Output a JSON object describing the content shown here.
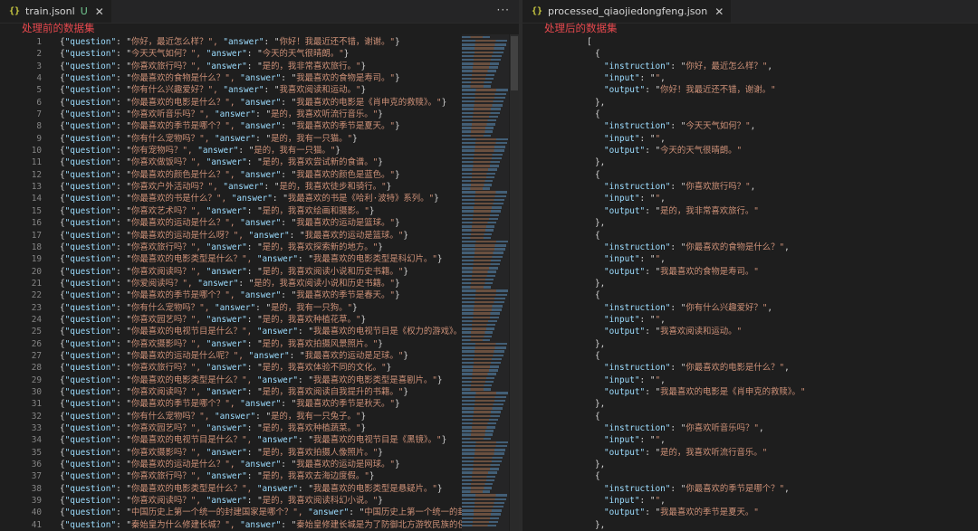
{
  "left": {
    "tab": {
      "icon": "json-braces-icon",
      "name": "train.jsonl",
      "status": "U"
    },
    "annotation": "处理前的数据集",
    "lines": [
      {
        "n": "1",
        "q": "你好，最近怎么样？",
        "a": "你好！我最近还不错，谢谢。"
      },
      {
        "n": "2",
        "q": "今天天气如何？",
        "a": "今天的天气很晴朗。"
      },
      {
        "n": "3",
        "q": "你喜欢旅行吗？",
        "a": "是的，我非常喜欢旅行。"
      },
      {
        "n": "4",
        "q": "你最喜欢的食物是什么？",
        "a": "我最喜欢的食物是寿司。"
      },
      {
        "n": "5",
        "q": "你有什么兴趣爱好？",
        "a": "我喜欢阅读和运动。"
      },
      {
        "n": "6",
        "q": "你最喜欢的电影是什么？",
        "a": "我最喜欢的电影是《肖申克的救赎》。"
      },
      {
        "n": "7",
        "q": "你喜欢听音乐吗？",
        "a": "是的，我喜欢听流行音乐。"
      },
      {
        "n": "8",
        "q": "你最喜欢的季节是哪个？",
        "a": "我最喜欢的季节是夏天。"
      },
      {
        "n": "9",
        "q": "你有什么宠物吗？",
        "a": "是的，我有一只猫。"
      },
      {
        "n": "10",
        "q": "你有宠物吗？",
        "a": "是的，我有一只猫。"
      },
      {
        "n": "11",
        "q": "你喜欢做饭吗？",
        "a": "是的，我喜欢尝试新的食谱。"
      },
      {
        "n": "12",
        "q": "你最喜欢的颜色是什么？",
        "a": "我最喜欢的颜色是蓝色。"
      },
      {
        "n": "13",
        "q": "你喜欢户外活动吗？",
        "a": "是的，我喜欢徒步和骑行。"
      },
      {
        "n": "14",
        "q": "你最喜欢的书是什么？",
        "a": "我最喜欢的书是《哈利·波特》系列。"
      },
      {
        "n": "15",
        "q": "你喜欢艺术吗？",
        "a": "是的，我喜欢绘画和摄影。"
      },
      {
        "n": "16",
        "q": "你最喜欢的运动是什么？",
        "a": "我最喜欢的运动是篮球。"
      },
      {
        "n": "17",
        "q": "你最喜欢的运动是什么呀？",
        "a": "我最喜欢的运动是篮球。"
      },
      {
        "n": "18",
        "q": "你喜欢旅行吗？",
        "a": "是的，我喜欢探索新的地方。"
      },
      {
        "n": "19",
        "q": "你最喜欢的电影类型是什么？",
        "a": "我最喜欢的电影类型是科幻片。"
      },
      {
        "n": "20",
        "q": "你喜欢阅读吗？",
        "a": "是的，我喜欢阅读小说和历史书籍。"
      },
      {
        "n": "21",
        "q": "你爱阅读吗？",
        "a": "是的，我喜欢阅读小说和历史书籍。"
      },
      {
        "n": "22",
        "q": "你最喜欢的季节是哪个？",
        "a": "我最喜欢的季节是春天。"
      },
      {
        "n": "23",
        "q": "你有什么宠物吗？",
        "a": "是的，我有一只狗。"
      },
      {
        "n": "24",
        "q": "你喜欢园艺吗？",
        "a": "是的，我喜欢种植花草。"
      },
      {
        "n": "25",
        "q": "你最喜欢的电视节目是什么？",
        "a": "我最喜欢的电视节目是《权力的游戏》。"
      },
      {
        "n": "26",
        "q": "你喜欢摄影吗？",
        "a": "是的，我喜欢拍摄风景照片。"
      },
      {
        "n": "27",
        "q": "你最喜欢的运动是什么呢？",
        "a": "我最喜欢的运动是足球。"
      },
      {
        "n": "28",
        "q": "你喜欢旅行吗？",
        "a": "是的，我喜欢体验不同的文化。"
      },
      {
        "n": "29",
        "q": "你最喜欢的电影类型是什么？",
        "a": "我最喜欢的电影类型是喜剧片。"
      },
      {
        "n": "30",
        "q": "你喜欢阅读吗？",
        "a": "是的，我喜欢阅读自我提升的书籍。"
      },
      {
        "n": "31",
        "q": "你最喜欢的季节是哪个？",
        "a": "我最喜欢的季节是秋天。"
      },
      {
        "n": "32",
        "q": "你有什么宠物吗？",
        "a": "是的，我有一只兔子。"
      },
      {
        "n": "33",
        "q": "你喜欢园艺吗？",
        "a": "是的，我喜欢种植蔬菜。"
      },
      {
        "n": "34",
        "q": "你最喜欢的电视节目是什么？",
        "a": "我最喜欢的电视节目是《黑镜》。"
      },
      {
        "n": "35",
        "q": "你喜欢摄影吗？",
        "a": "是的，我喜欢拍摄人像照片。"
      },
      {
        "n": "36",
        "q": "你最喜欢的运动是什么？",
        "a": "我最喜欢的运动是网球。"
      },
      {
        "n": "37",
        "q": "你喜欢旅行吗？",
        "a": "是的，我喜欢去海边度假。"
      },
      {
        "n": "38",
        "q": "你最喜欢的电影类型是什么？",
        "a": "我最喜欢的电影类型是悬疑片。"
      },
      {
        "n": "39",
        "q": "你喜欢阅读吗？",
        "a": "是的，我喜欢阅读科幻小说。"
      },
      {
        "n": "40",
        "q": "中国历史上第一个统一的封建国家是哪个？",
        "a": "中国历史上第一个统一的封建国"
      },
      {
        "n": "41",
        "q": "秦始皇为什么修建长城？",
        "a": "秦始皇修建长城是为了防御北方游牧民族的侵扰。"
      }
    ]
  },
  "right": {
    "tab": {
      "icon": "json-braces-icon",
      "name": "processed_qiaojiedongfeng.json"
    },
    "annotation": "处理后的数据集",
    "lines": [
      {
        "n": "1",
        "kind": "open_bracket",
        "text": "["
      },
      {
        "n": "2",
        "kind": "open",
        "text": "{"
      },
      {
        "n": "3",
        "kind": "kv",
        "k": "instruction",
        "v": "你好，最近怎么样？"
      },
      {
        "n": "4",
        "kind": "kv",
        "k": "input",
        "v": ""
      },
      {
        "n": "5",
        "kind": "kv_last",
        "k": "output",
        "v": "你好！我最近还不错，谢谢。"
      },
      {
        "n": "6",
        "kind": "close",
        "text": "},"
      },
      {
        "n": "7",
        "kind": "open",
        "text": "{"
      },
      {
        "n": "8",
        "kind": "kv",
        "k": "instruction",
        "v": "今天天气如何？"
      },
      {
        "n": "9",
        "kind": "kv",
        "k": "input",
        "v": ""
      },
      {
        "n": "10",
        "kind": "kv_last",
        "k": "output",
        "v": "今天的天气很晴朗。"
      },
      {
        "n": "11",
        "kind": "close",
        "text": "},"
      },
      {
        "n": "12",
        "kind": "open",
        "text": "{"
      },
      {
        "n": "13",
        "kind": "kv",
        "k": "instruction",
        "v": "你喜欢旅行吗？"
      },
      {
        "n": "14",
        "kind": "kv",
        "k": "input",
        "v": ""
      },
      {
        "n": "15",
        "kind": "kv_last",
        "k": "output",
        "v": "是的，我非常喜欢旅行。"
      },
      {
        "n": "16",
        "kind": "close",
        "text": "},"
      },
      {
        "n": "17",
        "kind": "open",
        "text": "{"
      },
      {
        "n": "18",
        "kind": "kv",
        "k": "instruction",
        "v": "你最喜欢的食物是什么？"
      },
      {
        "n": "19",
        "kind": "kv",
        "k": "input",
        "v": ""
      },
      {
        "n": "20",
        "kind": "kv_last",
        "k": "output",
        "v": "我最喜欢的食物是寿司。"
      },
      {
        "n": "21",
        "kind": "close",
        "text": "},"
      },
      {
        "n": "22",
        "kind": "open",
        "text": "{"
      },
      {
        "n": "23",
        "kind": "kv",
        "k": "instruction",
        "v": "你有什么兴趣爱好？"
      },
      {
        "n": "24",
        "kind": "kv",
        "k": "input",
        "v": ""
      },
      {
        "n": "25",
        "kind": "kv_last",
        "k": "output",
        "v": "我喜欢阅读和运动。"
      },
      {
        "n": "26",
        "kind": "close",
        "text": "},"
      },
      {
        "n": "27",
        "kind": "open",
        "text": "{"
      },
      {
        "n": "28",
        "kind": "kv",
        "k": "instruction",
        "v": "你最喜欢的电影是什么？"
      },
      {
        "n": "29",
        "kind": "kv",
        "k": "input",
        "v": ""
      },
      {
        "n": "30",
        "kind": "kv_last",
        "k": "output",
        "v": "我最喜欢的电影是《肖申克的救赎》。"
      },
      {
        "n": "31",
        "kind": "close",
        "text": "},"
      },
      {
        "n": "32",
        "kind": "open",
        "text": "{"
      },
      {
        "n": "33",
        "kind": "kv",
        "k": "instruction",
        "v": "你喜欢听音乐吗？"
      },
      {
        "n": "34",
        "kind": "kv",
        "k": "input",
        "v": ""
      },
      {
        "n": "35",
        "kind": "kv_last",
        "k": "output",
        "v": "是的，我喜欢听流行音乐。"
      },
      {
        "n": "36",
        "kind": "close",
        "text": "},"
      },
      {
        "n": "37",
        "kind": "open",
        "text": "{"
      },
      {
        "n": "38",
        "kind": "kv",
        "k": "instruction",
        "v": "你最喜欢的季节是哪个？"
      },
      {
        "n": "39",
        "kind": "kv",
        "k": "input",
        "v": ""
      },
      {
        "n": "40",
        "kind": "kv_last",
        "k": "output",
        "v": "我最喜欢的季节是夏天。"
      },
      {
        "n": "41",
        "kind": "close",
        "text": "},"
      }
    ]
  }
}
